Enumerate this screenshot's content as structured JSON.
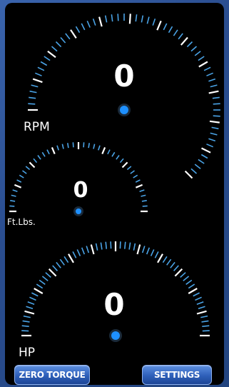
{
  "gauges": {
    "rpm": {
      "value": "0",
      "label": "RPM",
      "level": 0
    },
    "torque": {
      "value": "0",
      "label": "Ft.Lbs.",
      "level": 0
    },
    "hp": {
      "value": "0",
      "label": "HP",
      "level": 0
    }
  },
  "buttons": {
    "zero_torque": "ZERO TORQUE",
    "settings": "SETTINGS"
  },
  "colors": {
    "background": "#2a4d8f",
    "panel": "#000000",
    "tick_major": "#ffffff",
    "tick_minor": "#4aa3e6",
    "needle": "#d38a2a",
    "hub": "#1e90ff",
    "button": "#2e5fb9"
  }
}
